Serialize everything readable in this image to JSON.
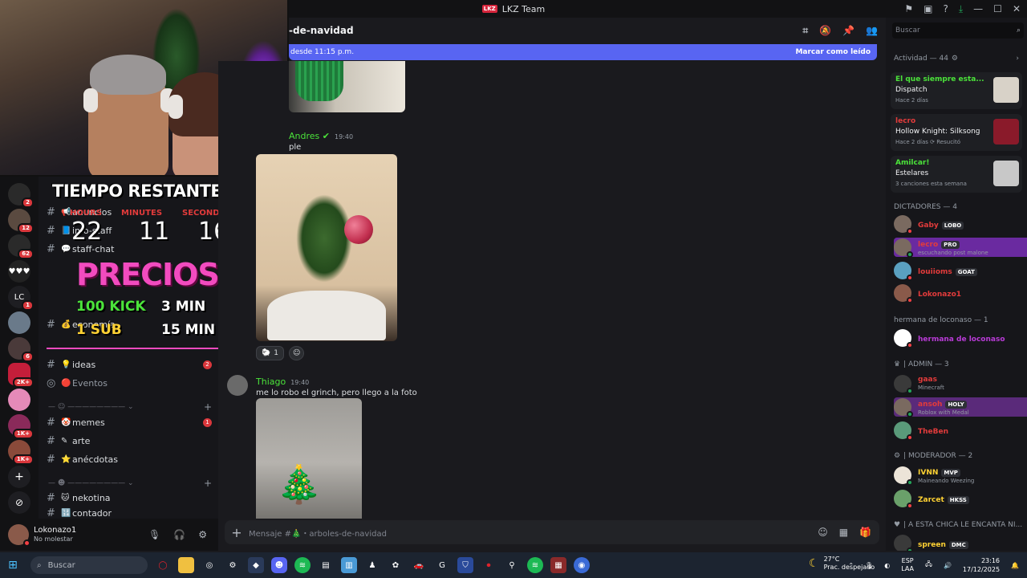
{
  "titlebar": {
    "logo": "LKZ",
    "title": "LKZ Team"
  },
  "header": {
    "channel": "-de-navidad"
  },
  "banner": {
    "text": "desde 11:15 p.m.",
    "action": "Marcar como leído"
  },
  "timer": {
    "title": "TIEMPO RESTANTE:",
    "hours_label": "HOURS",
    "minutes_label": "MINUTES",
    "seconds_label": "SECONDS",
    "hours": "22",
    "minutes": "11",
    "seconds": "16",
    "precios": "PRECIOS",
    "kick": "100 KICK",
    "kick_time": "3 MIN",
    "sub": "1 SUB",
    "sub_time": "15 MIN"
  },
  "channels": [
    {
      "name": "anuncios"
    },
    {
      "name": "info-staff"
    },
    {
      "name": "staff-chat"
    },
    {
      "name": "economía"
    },
    {
      "name": "ideas",
      "count": "2"
    },
    {
      "name": "Eventos"
    },
    {
      "name": "memes",
      "count": "1"
    },
    {
      "name": "arte"
    },
    {
      "name": "anécdotas"
    },
    {
      "name": "nekotina"
    },
    {
      "name": "contador"
    }
  ],
  "rail_badges": [
    "2",
    "12",
    "62",
    "1",
    "6",
    "2K+",
    "1K+",
    "1K+"
  ],
  "rail_text": "LC",
  "messages": [
    {
      "author": "Andres",
      "time": "19:40",
      "text": "ple"
    },
    {
      "author": "Thiago",
      "time": "19:40",
      "text": "me lo robo el grinch, pero llego a la foto"
    }
  ],
  "reaction": {
    "count": "1"
  },
  "composer": {
    "placeholder": "Mensaje #🎄・arboles-de-navidad"
  },
  "user": {
    "name": "Lokonazo1",
    "status": "No molestar"
  },
  "members": {
    "search_placeholder": "Buscar",
    "activity_header": "Actividad — 44",
    "activities": [
      {
        "user": "El que siempre esta...",
        "title": "Dispatch",
        "sub": "Hace 2 días"
      },
      {
        "user": "lecro",
        "title": "Hollow Knight: Silksong",
        "sub": "Hace 2 días  ⟳ Resucitó"
      },
      {
        "user": "Amilcar!",
        "title": "Estelares",
        "sub": "3 canciones esta semana"
      }
    ],
    "groups": [
      {
        "header": "DICTADORES — 4",
        "members": [
          {
            "name": "Gaby",
            "tag": "LOBO",
            "sub": "",
            "color": "#e23b3b"
          },
          {
            "name": "lecro",
            "tag": "PRO",
            "sub": "escuchando post malone",
            "color": "#e23b3b"
          },
          {
            "name": "louiioms",
            "tag": "GOAT",
            "sub": "",
            "color": "#e23b3b"
          },
          {
            "name": "Lokonazo1",
            "tag": "",
            "sub": "",
            "color": "#e23b3b"
          }
        ]
      },
      {
        "header": "hermana de loconaso — 1",
        "members": [
          {
            "name": "hermana de loconaso",
            "tag": "",
            "sub": "",
            "color": "#b83bd6"
          }
        ]
      },
      {
        "header": "| ADMIN — 3",
        "members": [
          {
            "name": "gaas",
            "tag": "",
            "sub": "Minecraft",
            "color": "#e23b3b"
          },
          {
            "name": "ansoh",
            "tag": "HOLY",
            "sub": "Roblox with Medal",
            "color": "#e23b3b"
          },
          {
            "name": "TheBen",
            "tag": "",
            "sub": "",
            "color": "#e23b3b"
          }
        ]
      },
      {
        "header": "| MODERADOR — 2",
        "members": [
          {
            "name": "IVNN",
            "tag": "MVP",
            "sub": "Maineando Weezing",
            "color": "#ffd233"
          },
          {
            "name": "Zarcet",
            "tag": "HKSS",
            "sub": "",
            "color": "#ffd233"
          }
        ]
      },
      {
        "header": "| A ESTA CHICA LE ENCANTA NI...",
        "members": [
          {
            "name": "spreen",
            "tag": "DMC",
            "sub": "",
            "color": "#ffd233"
          }
        ]
      }
    ]
  },
  "taskbar": {
    "search": "Buscar",
    "weather_temp": "27°C",
    "weather_desc": "Prac. despejado",
    "lang1": "ESP",
    "lang2": "LAA",
    "time": "23:16",
    "date": "17/12/2025"
  },
  "colors": {
    "accent": "#5865f2",
    "pink": "#f24bbf",
    "green": "#4be33a",
    "red": "#da373c"
  }
}
